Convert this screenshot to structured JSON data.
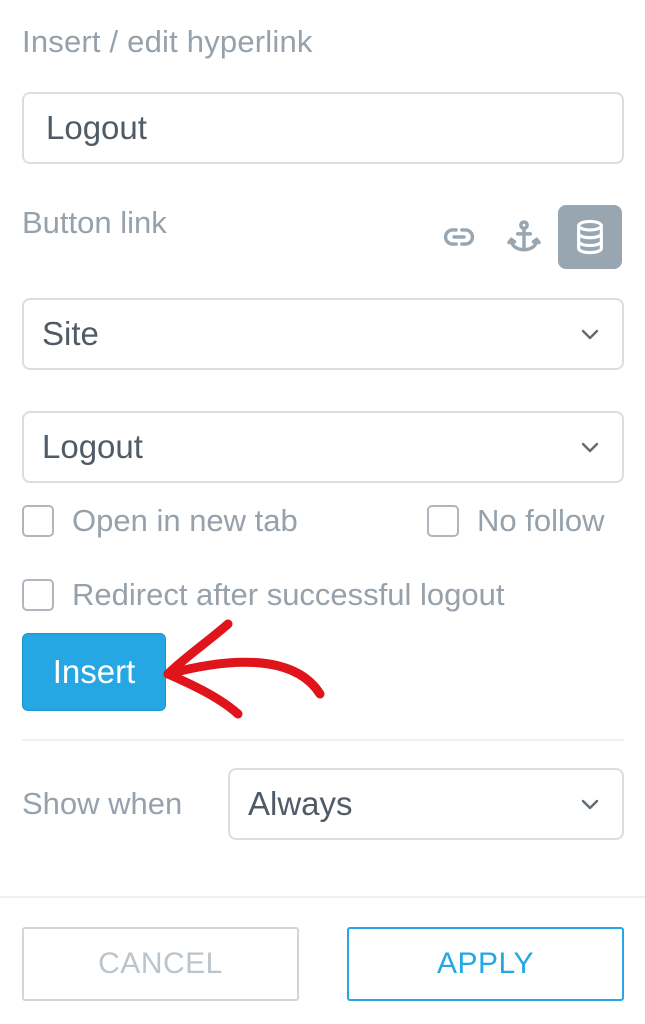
{
  "dialog": {
    "title": "Insert / edit hyperlink",
    "link_text_value": "Logout"
  },
  "button_link": {
    "label": "Button link",
    "icons": [
      "link-icon",
      "anchor-icon",
      "database-icon"
    ],
    "active_icon": "database-icon"
  },
  "link_type_select": {
    "value": "Site"
  },
  "page_select": {
    "value": "Logout"
  },
  "options": {
    "open_new_tab": {
      "label": "Open in new tab",
      "checked": false
    },
    "no_follow": {
      "label": "No follow",
      "checked": false
    },
    "redirect": {
      "label": "Redirect after successful logout",
      "checked": false
    }
  },
  "insert_button": {
    "label": "Insert"
  },
  "show_when": {
    "label": "Show when",
    "value": "Always"
  },
  "footer": {
    "cancel_label": "CANCEL",
    "apply_label": "APPLY"
  },
  "colors": {
    "accent": "#25a7e4",
    "annotation_arrow": "#e0141b",
    "muted_text": "#96a1ab"
  }
}
